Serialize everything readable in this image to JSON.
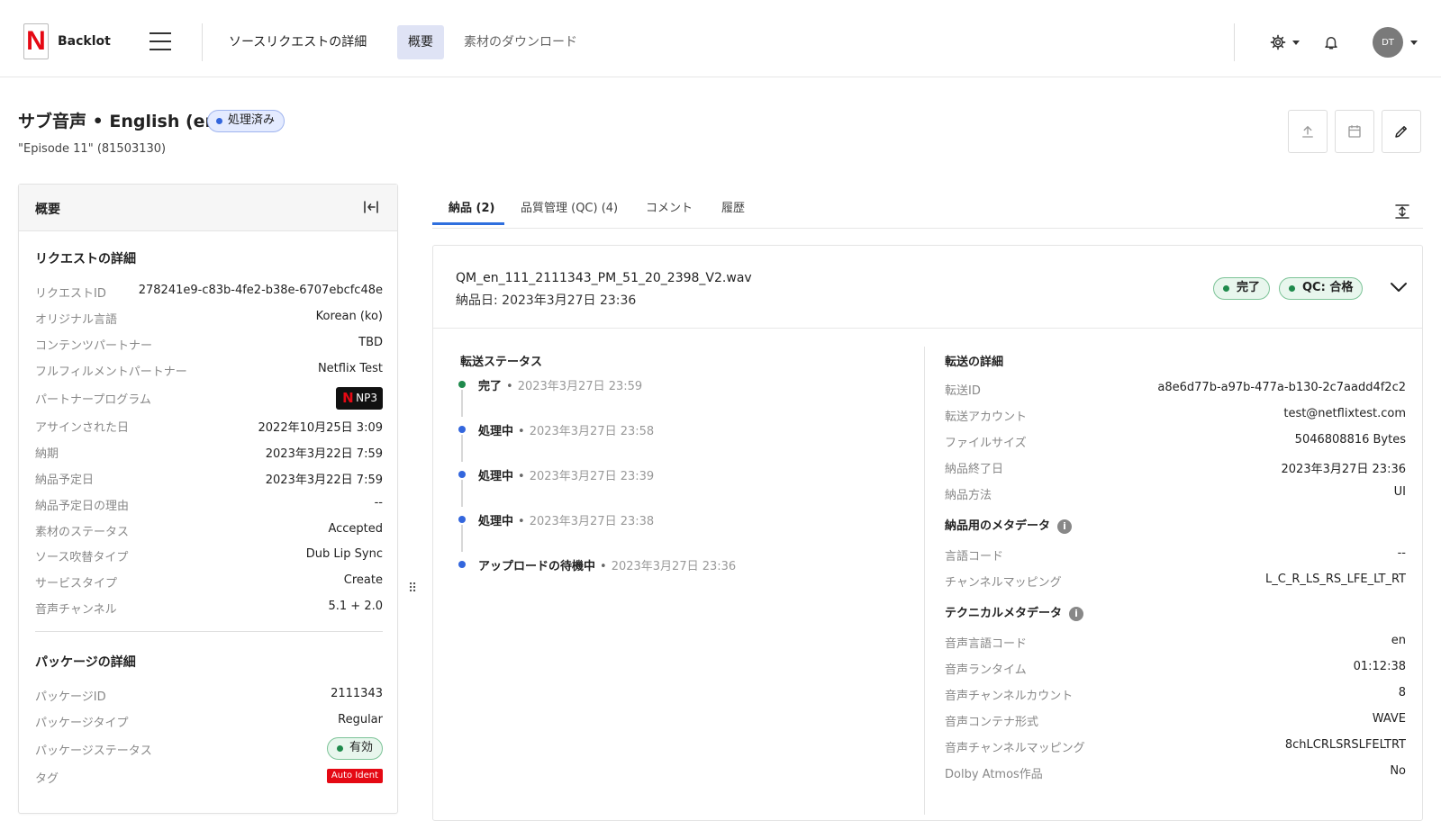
{
  "header": {
    "logo_letter": "N",
    "brand": "Backlot",
    "nav": [
      {
        "label": "ソースリクエストの詳細"
      },
      {
        "label": "概要"
      },
      {
        "label": "素材のダウンロード"
      }
    ],
    "avatar": "DT"
  },
  "page": {
    "title": "サブ音声 • English (en)",
    "status_badge": "処理済み",
    "subtitle": "\"Episode 11\" (81503130)"
  },
  "overview": {
    "title": "概要",
    "request_section": "リクエストの詳細",
    "request_rows": [
      {
        "k": "リクエストID",
        "v": "278241e9-c83b-4fe2-b38e-6707ebcfc48e"
      },
      {
        "k": "オリジナル言語",
        "v": "Korean (ko)"
      },
      {
        "k": "コンテンツパートナー",
        "v": "TBD"
      },
      {
        "k": "フルフィルメントパートナー",
        "v": "Netflix Test"
      },
      {
        "k": "パートナープログラム",
        "v": "NP3"
      },
      {
        "k": "アサインされた日",
        "v": "2022年10月25日 3:09"
      },
      {
        "k": "納期",
        "v": "2023年3月22日 7:59"
      },
      {
        "k": "納品予定日",
        "v": "2023年3月22日 7:59"
      },
      {
        "k": "納品予定日の理由",
        "v": "--"
      },
      {
        "k": "素材のステータス",
        "v": "Accepted"
      },
      {
        "k": "ソース吹替タイプ",
        "v": "Dub Lip Sync"
      },
      {
        "k": "サービスタイプ",
        "v": "Create"
      },
      {
        "k": "音声チャンネル",
        "v": "5.1 + 2.0"
      }
    ],
    "package_section": "パッケージの詳細",
    "package_rows": [
      {
        "k": "パッケージID",
        "v": "2111343"
      },
      {
        "k": "パッケージタイプ",
        "v": "Regular"
      },
      {
        "k": "パッケージステータス",
        "v": "有効"
      },
      {
        "k": "タグ",
        "v": "Auto Ident"
      }
    ]
  },
  "tabs": [
    {
      "label": "納品 (2)"
    },
    {
      "label": "品質管理 (QC) (4)"
    },
    {
      "label": "コメント"
    },
    {
      "label": "履歴"
    }
  ],
  "delivery": {
    "filename": "QM_en_111_2111343_PM_51_20_2398_V2.wav",
    "delivered": "納品日: 2023年3月27日 23:36",
    "badge_done": "完了",
    "badge_qc": "QC: 合格",
    "transfer_status_title": "転送ステータス",
    "timeline": [
      {
        "status": "完了",
        "time": "2023年3月27日 23:59",
        "color": "#1f8a4c"
      },
      {
        "status": "処理中",
        "time": "2023年3月27日 23:58",
        "color": "#3366dd"
      },
      {
        "status": "処理中",
        "time": "2023年3月27日 23:39",
        "color": "#3366dd"
      },
      {
        "status": "処理中",
        "time": "2023年3月27日 23:38",
        "color": "#3366dd"
      },
      {
        "status": "アップロードの待機中",
        "time": "2023年3月27日 23:36",
        "color": "#3366dd"
      }
    ],
    "transfer_details_title": "転送の詳細",
    "transfer_rows": [
      {
        "k": "転送ID",
        "v": "a8e6d77b-a97b-477a-b130-2c7aadd4f2c2"
      },
      {
        "k": "転送アカウント",
        "v": "test@netflixtest.com"
      },
      {
        "k": "ファイルサイズ",
        "v": "5046808816 Bytes"
      },
      {
        "k": "納品終了日",
        "v": "2023年3月27日 23:36"
      },
      {
        "k": "納品方法",
        "v": "UI"
      }
    ],
    "metadata_title": "納品用のメタデータ",
    "metadata_rows": [
      {
        "k": "言語コード",
        "v": "--"
      },
      {
        "k": "チャンネルマッピング",
        "v": "L_C_R_LS_RS_LFE_LT_RT"
      }
    ],
    "technical_title": "テクニカルメタデータ",
    "technical_rows": [
      {
        "k": "音声言語コード",
        "v": "en"
      },
      {
        "k": "音声ランタイム",
        "v": "01:12:38"
      },
      {
        "k": "音声チャンネルカウント",
        "v": "8"
      },
      {
        "k": "音声コンテナ形式",
        "v": "WAVE"
      },
      {
        "k": "音声チャンネルマッピング",
        "v": "8chLCRLSRSLFELTRT"
      },
      {
        "k": "Dolby Atmos作品",
        "v": "No"
      }
    ]
  },
  "colors": {
    "accent": "#2f6fde",
    "brand": "#e50914",
    "success": "#1f8a4c"
  }
}
